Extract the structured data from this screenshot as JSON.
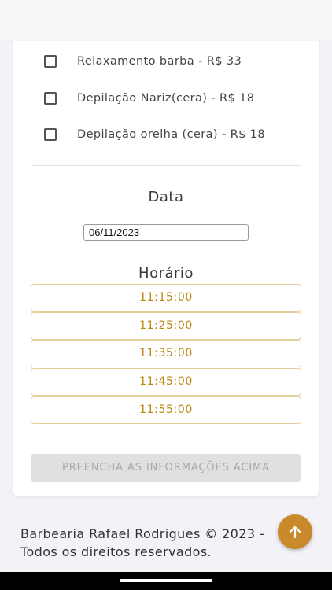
{
  "services": [
    {
      "label": "Relaxamento barba - R$ 33",
      "checked": false
    },
    {
      "label": "Depilação Nariz(cera) - R$ 18",
      "checked": false
    },
    {
      "label": "Depilação orelha (cera) - R$ 18",
      "checked": false
    }
  ],
  "date_section": {
    "title": "Data",
    "value": "06/11/2023"
  },
  "time_section": {
    "title": "Horário",
    "slots": [
      "11:15:00",
      "11:25:00",
      "11:35:00",
      "11:45:00",
      "11:55:00"
    ]
  },
  "submit": {
    "label": "PREENCHA AS INFORMAÇÕES ACIMA",
    "disabled": true
  },
  "footer": {
    "text": "Barbearia Rafael Rodrigues © 2023 - Todos os direitos reservados."
  },
  "colors": {
    "accent": "#c88a2b",
    "slot_text": "#b8860b",
    "slot_border": "#e3cf9a"
  },
  "icons": {
    "fab": "arrow-up-icon",
    "checkbox": "checkbox-unchecked-icon"
  }
}
